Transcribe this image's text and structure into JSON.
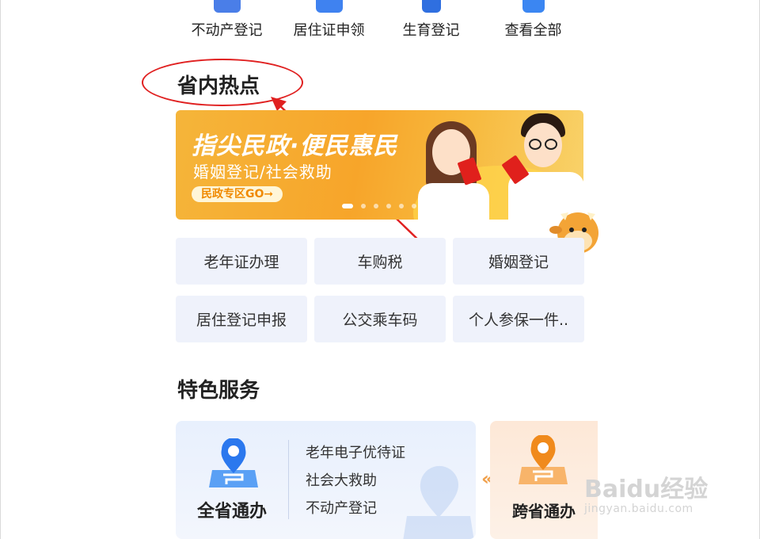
{
  "top_services": [
    {
      "label": "不动产登记",
      "icon": "house-doc-icon",
      "color": "#4a7ee8"
    },
    {
      "label": "居住证申领",
      "icon": "id-card-icon",
      "color": "#3f82f0"
    },
    {
      "label": "生育登记",
      "icon": "baby-doc-icon",
      "color": "#2f6fe0"
    },
    {
      "label": "查看全部",
      "icon": "grid-icon",
      "color": "#3b86f2"
    }
  ],
  "hot": {
    "title": "省内热点",
    "banner": {
      "title": "指尖民政·便民惠民",
      "subtitle": "婚姻登记/社会救助",
      "button": "民政专区GO➞"
    },
    "items": [
      "老年证办理",
      "车购税",
      "婚姻登记",
      "居住登记申报",
      "公交乘车码",
      "个人参保一件.."
    ]
  },
  "featured": {
    "title": "特色服务",
    "card_a": {
      "name": "全省通办",
      "items": [
        "老年电子优待证",
        "社会大救助",
        "不动产登记"
      ]
    },
    "card_b": {
      "name": "跨省通办"
    },
    "chevron": "«"
  },
  "watermark": {
    "main": "Baidu经验",
    "sub": "jingyan.baidu.com"
  },
  "colors": {
    "annotation": "#e02020",
    "accent_blue": "#3f82f0",
    "accent_orange": "#f08a00"
  }
}
